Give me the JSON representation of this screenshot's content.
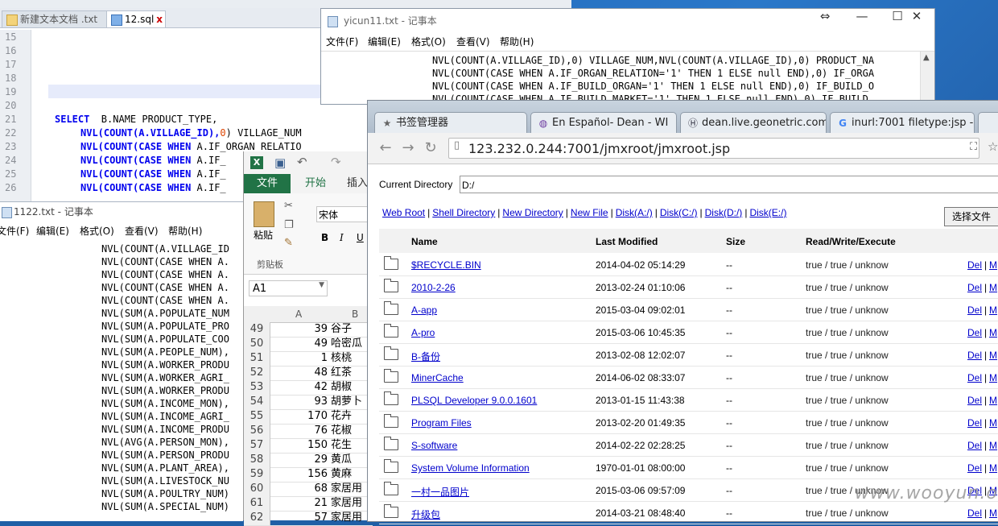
{
  "sql_editor": {
    "tabs": [
      {
        "label": "新建文本文档 .txt"
      },
      {
        "label": "12.sql"
      }
    ],
    "line_numbers": [
      "15",
      "16",
      "17",
      "18",
      "19",
      "20",
      "21",
      "22",
      "23",
      "24",
      "25",
      "26"
    ],
    "line21": {
      "kw": "SELECT",
      "rest": "  B.NAME PRODUCT_TYPE,"
    },
    "line22": {
      "a": "NVL(COUNT(A.VILLAGE_ID),",
      "n": "0",
      "b": ") VILLAGE_NUM"
    },
    "line23": {
      "a": "NVL(COUNT(",
      "kw1": "CASE",
      "kw2": "WHEN",
      "b": " A.IF_ORGAN_RELATIO"
    },
    "line24": {
      "a": "NVL(COUNT(",
      "kw1": "CASE",
      "kw2": "WHEN",
      "b": " A.IF_"
    },
    "line25": {
      "a": "NVL(COUNT(",
      "kw1": "CASE",
      "kw2": "WHEN",
      "b": " A.IF_"
    },
    "line26": {
      "a": "NVL(COUNT(",
      "kw1": "CASE",
      "kw2": "WHEN",
      "b": " A.IF_"
    }
  },
  "notepad1": {
    "title": "1122.txt - 记事本",
    "menu": [
      "文件(F)",
      "编辑(E)",
      "格式(O)",
      "查看(V)",
      "帮助(H)"
    ],
    "lines": [
      "NVL(COUNT(A.VILLAGE_ID",
      "NVL(COUNT(CASE WHEN A.",
      "NVL(COUNT(CASE WHEN A.",
      "NVL(COUNT(CASE WHEN A.",
      "NVL(COUNT(CASE WHEN A.",
      "NVL(SUM(A.POPULATE_NUM",
      "NVL(SUM(A.POPULATE_PRO",
      "NVL(SUM(A.POPULATE_COO",
      "NVL(SUM(A.PEOPLE_NUM),",
      "NVL(SUM(A.WORKER_PRODU",
      "NVL(SUM(A.WORKER_AGRI_",
      "NVL(SUM(A.WORKER_PRODU",
      "NVL(SUM(A.INCOME_MON),",
      "NVL(SUM(A.INCOME_AGRI_",
      "NVL(SUM(A.INCOME_PRODU",
      "NVL(AVG(A.PERSON_MON),",
      "NVL(SUM(A.PERSON_PRODU",
      "NVL(SUM(A.PLANT_AREA),",
      "NVL(SUM(A.LIVESTOCK_NU",
      "NVL(SUM(A.POULTRY_NUM)",
      "NVL(SUM(A.SPECIAL_NUM)"
    ]
  },
  "excel": {
    "file_tab": "文件",
    "tabs": [
      "开始",
      "插入"
    ],
    "paste_label": "粘贴",
    "clipboard_label": "剪贴板",
    "font_name": "宋体",
    "bold": "B",
    "italic": "I",
    "underline": "U",
    "name_box": "A1",
    "col_a": "A",
    "col_b": "B",
    "rows": [
      {
        "n": "49",
        "a": "39",
        "b": "谷子"
      },
      {
        "n": "50",
        "a": "49",
        "b": "哈密瓜"
      },
      {
        "n": "51",
        "a": "1",
        "b": "核桃"
      },
      {
        "n": "52",
        "a": "48",
        "b": "红茶"
      },
      {
        "n": "53",
        "a": "42",
        "b": "胡椒"
      },
      {
        "n": "54",
        "a": "93",
        "b": "胡萝卜"
      },
      {
        "n": "55",
        "a": "170",
        "b": "花卉"
      },
      {
        "n": "56",
        "a": "76",
        "b": "花椒"
      },
      {
        "n": "57",
        "a": "150",
        "b": "花生"
      },
      {
        "n": "58",
        "a": "29",
        "b": "黄瓜"
      },
      {
        "n": "59",
        "a": "156",
        "b": "黄麻"
      },
      {
        "n": "60",
        "a": "68",
        "b": "家居用"
      },
      {
        "n": "61",
        "a": "21",
        "b": "家居用"
      },
      {
        "n": "62",
        "a": "57",
        "b": "家居用"
      }
    ]
  },
  "notepad2": {
    "title": "yicun11.txt - 记事本",
    "menu": [
      "文件(F)",
      "编辑(E)",
      "格式(O)",
      "查看(V)",
      "帮助(H)"
    ],
    "lines": [
      "NVL(COUNT(A.VILLAGE_ID),0) VILLAGE_NUM,NVL(COUNT(A.VILLAGE_ID),0) PRODUCT_NA",
      "NVL(COUNT(CASE WHEN A.IF_ORGAN_RELATION='1' THEN 1 ELSE null END),0) IF_ORGA",
      "NVL(COUNT(CASE WHEN A.IF_BUILD_ORGAN='1' THEN 1 ELSE null END),0) IF_BUILD_O",
      "NVL(COUNT(CASE WHEN A.IF_BUILD_MARKET='1' THEN 1 ELSE null END),0) IF_BUILD"
    ]
  },
  "browser": {
    "tabs": [
      {
        "label": "书签管理器",
        "icon": "★"
      },
      {
        "label": "En Español- Dean - WI",
        "icon": "◍"
      },
      {
        "label": "dean.live.geonetric.com",
        "icon": "Ⓗ"
      },
      {
        "label": "inurl:7001 filetype:jsp -",
        "icon": "G"
      }
    ],
    "url": "123.232.0.244:7001/jmxroot/jmxroot.jsp",
    "current_dir_label": "Current Directory",
    "current_dir": "D:/",
    "links": [
      "Web Root",
      "Shell Directory",
      "New Directory",
      "New File",
      "Disk(A:/)",
      "Disk(C:/)",
      "Disk(D:/)",
      "Disk(E:/)"
    ],
    "upload_button": "选择文件",
    "headers": {
      "name": "Name",
      "modified": "Last Modified",
      "size": "Size",
      "perm": "Read/Write/Execute"
    },
    "del_label": "Del",
    "more_label": "M",
    "separator": "|",
    "files": [
      {
        "name": "$RECYCLE.BIN",
        "modified": "2014-04-02 05:14:29",
        "size": "--",
        "perm": "true / true / unknow"
      },
      {
        "name": "2010-2-26",
        "modified": "2013-02-24 01:10:06",
        "size": "--",
        "perm": "true / true / unknow"
      },
      {
        "name": "A-app",
        "modified": "2015-03-04 09:02:01",
        "size": "--",
        "perm": "true / true / unknow"
      },
      {
        "name": "A-pro",
        "modified": "2015-03-06 10:45:35",
        "size": "--",
        "perm": "true / true / unknow"
      },
      {
        "name": "B-备份",
        "modified": "2013-02-08 12:02:07",
        "size": "--",
        "perm": "true / true / unknow"
      },
      {
        "name": "MinerCache",
        "modified": "2014-06-02 08:33:07",
        "size": "--",
        "perm": "true / true / unknow"
      },
      {
        "name": "PLSQL Developer 9.0.0.1601",
        "modified": "2013-01-15 11:43:38",
        "size": "--",
        "perm": "true / true / unknow"
      },
      {
        "name": "Program Files",
        "modified": "2013-02-20 01:49:35",
        "size": "--",
        "perm": "true / true / unknow"
      },
      {
        "name": "S-software",
        "modified": "2014-02-22 02:28:25",
        "size": "--",
        "perm": "true / true / unknow"
      },
      {
        "name": "System Volume Information",
        "modified": "1970-01-01 08:00:00",
        "size": "--",
        "perm": "true / true / unknow"
      },
      {
        "name": "一村一品图片",
        "modified": "2015-03-06 09:57:09",
        "size": "--",
        "perm": "true / true / unknow"
      },
      {
        "name": "升级包",
        "modified": "2014-03-21 08:48:40",
        "size": "--",
        "perm": "true / true / unknow"
      }
    ]
  },
  "watermark": "www.wooyun.org"
}
